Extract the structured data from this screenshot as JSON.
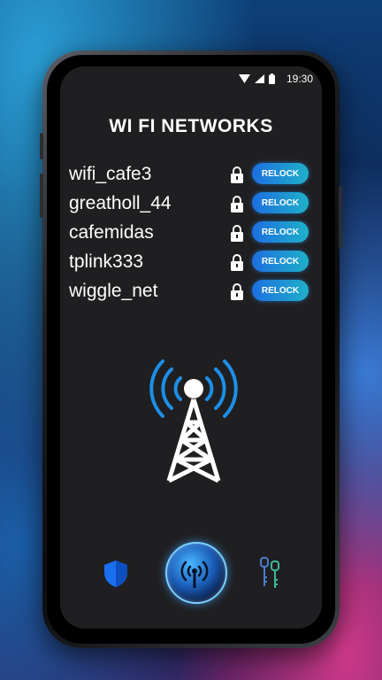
{
  "status_bar": {
    "time": "19:30"
  },
  "title": "WI FI NETWORKS",
  "networks": [
    {
      "name": "wifi_cafe3",
      "button": "RELOCK"
    },
    {
      "name": "greatholl_44",
      "button": "RELOCK"
    },
    {
      "name": "cafemidas",
      "button": "RELOCK"
    },
    {
      "name": "tplink333",
      "button": "RELOCK"
    },
    {
      "name": "wiggle_net",
      "button": "RELOCK"
    }
  ],
  "icons": {
    "tower": "wifi-tower-icon",
    "nav_left": "shield-icon",
    "nav_center": "wifi-scan-icon",
    "nav_right": "keys-icon"
  },
  "colors": {
    "accent": "#1d8fe8",
    "button_gradient_start": "#1d6fe0",
    "button_gradient_end": "#1fb0c9",
    "screen_bg": "#1f1f21"
  }
}
